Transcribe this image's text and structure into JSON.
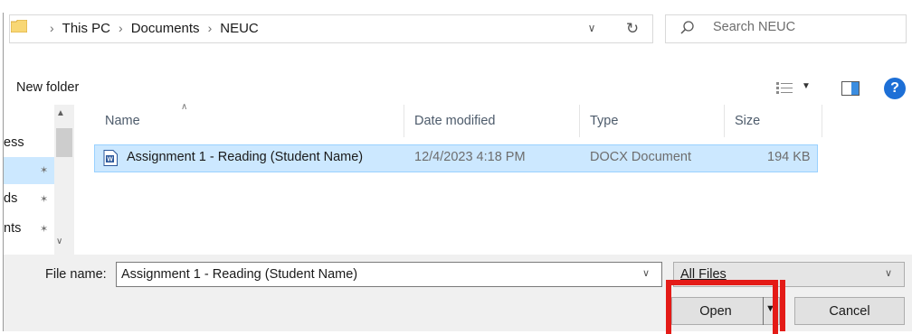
{
  "address_bar": {
    "crumbs": [
      "This PC",
      "Documents",
      "NEUC"
    ]
  },
  "search": {
    "placeholder": "Search NEUC"
  },
  "toolbar": {
    "new_folder_label": "New folder"
  },
  "nav_pane": {
    "items": [
      {
        "label": "ess",
        "pinned": false
      },
      {
        "label": "",
        "pinned": true,
        "selected": true
      },
      {
        "label": "ds",
        "pinned": true
      },
      {
        "label": "nts",
        "pinned": true
      }
    ]
  },
  "file_list": {
    "columns": [
      "Name",
      "Date modified",
      "Type",
      "Size"
    ],
    "rows": [
      {
        "name": "Assignment 1 - Reading (Student Name)",
        "date_modified": "12/4/2023 4:18 PM",
        "type": "DOCX Document",
        "size": "194 KB",
        "selected": true
      }
    ]
  },
  "file_name": {
    "label": "File name:",
    "value": "Assignment 1 - Reading (Student Name)"
  },
  "file_type_filter": {
    "selected": "All Files"
  },
  "buttons": {
    "open": "Open",
    "cancel": "Cancel"
  },
  "colors": {
    "selection": "#cce8ff",
    "highlight_box": "#e41b17",
    "help_icon": "#1d6fd6",
    "folder_icon": "#f8d775"
  }
}
